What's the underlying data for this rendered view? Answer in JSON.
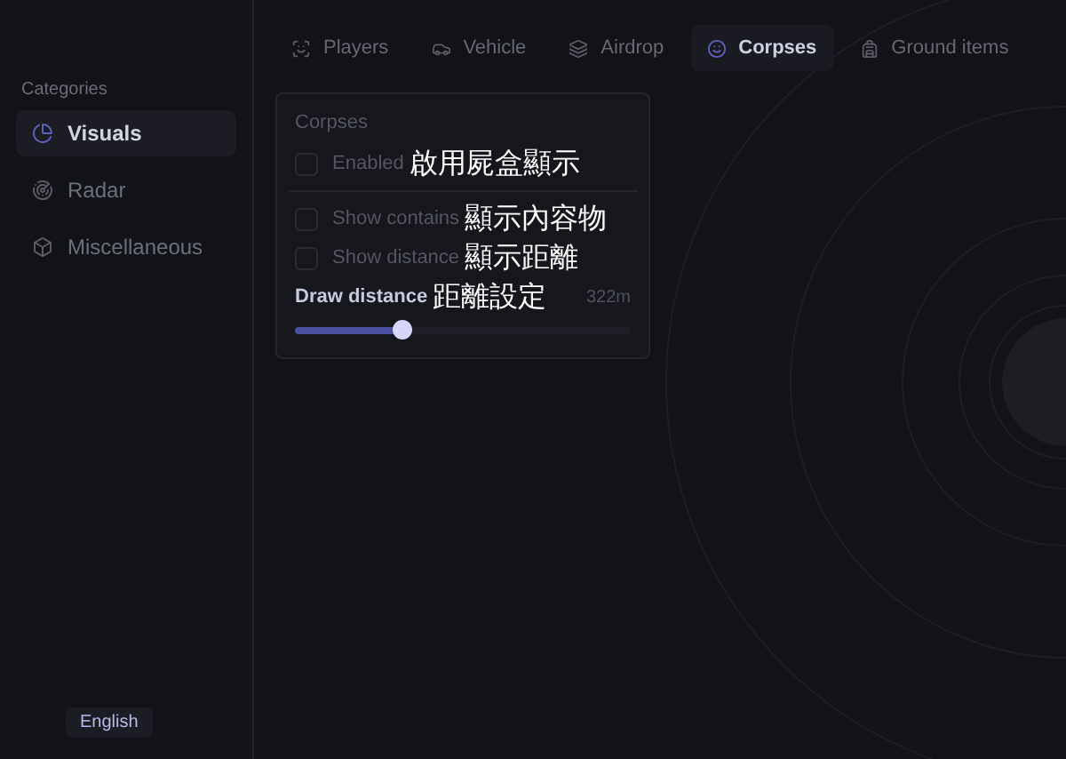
{
  "sidebar": {
    "heading": "Categories",
    "items": [
      {
        "label": "Visuals",
        "kind": "visuals",
        "selected": true
      },
      {
        "label": "Radar",
        "kind": "radar",
        "selected": false
      },
      {
        "label": "Miscellaneous",
        "kind": "misc",
        "selected": false
      }
    ],
    "language_button": "English"
  },
  "tabs": [
    {
      "label": "Players",
      "kind": "players",
      "selected": false
    },
    {
      "label": "Vehicle",
      "kind": "vehicle",
      "selected": false
    },
    {
      "label": "Airdrop",
      "kind": "airdrop",
      "selected": false
    },
    {
      "label": "Corpses",
      "kind": "corpses",
      "selected": true
    },
    {
      "label": "Ground items",
      "kind": "ground",
      "selected": false
    }
  ],
  "panel": {
    "title": "Corpses",
    "rows": [
      {
        "kind": "checkbox",
        "label": "Enabled",
        "annotation": "啟用屍盒顯示",
        "checked": false
      },
      {
        "kind": "divider"
      },
      {
        "kind": "checkbox",
        "label": "Show contains",
        "annotation": "顯示內容物",
        "checked": false
      },
      {
        "kind": "checkbox",
        "label": "Show distance",
        "annotation": "顯示距離",
        "checked": false
      },
      {
        "kind": "slider",
        "label": "Draw distance",
        "annotation": "距離設定",
        "reading": "322m",
        "level": 0.32
      }
    ]
  }
}
